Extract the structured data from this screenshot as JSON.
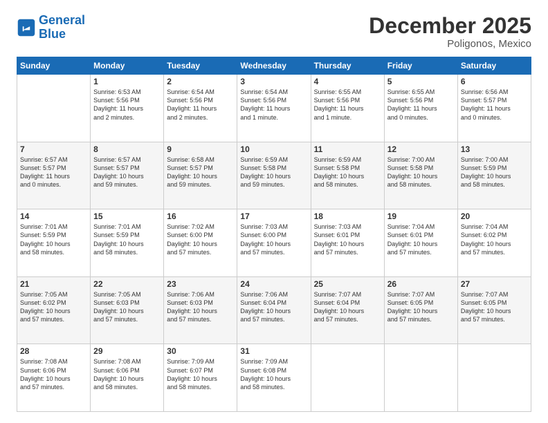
{
  "header": {
    "logo_line1": "General",
    "logo_line2": "Blue",
    "month": "December 2025",
    "location": "Poligonos, Mexico"
  },
  "days_of_week": [
    "Sunday",
    "Monday",
    "Tuesday",
    "Wednesday",
    "Thursday",
    "Friday",
    "Saturday"
  ],
  "weeks": [
    [
      {
        "day": "",
        "text": ""
      },
      {
        "day": "1",
        "text": "Sunrise: 6:53 AM\nSunset: 5:56 PM\nDaylight: 11 hours\nand 2 minutes."
      },
      {
        "day": "2",
        "text": "Sunrise: 6:54 AM\nSunset: 5:56 PM\nDaylight: 11 hours\nand 2 minutes."
      },
      {
        "day": "3",
        "text": "Sunrise: 6:54 AM\nSunset: 5:56 PM\nDaylight: 11 hours\nand 1 minute."
      },
      {
        "day": "4",
        "text": "Sunrise: 6:55 AM\nSunset: 5:56 PM\nDaylight: 11 hours\nand 1 minute."
      },
      {
        "day": "5",
        "text": "Sunrise: 6:55 AM\nSunset: 5:56 PM\nDaylight: 11 hours\nand 0 minutes."
      },
      {
        "day": "6",
        "text": "Sunrise: 6:56 AM\nSunset: 5:57 PM\nDaylight: 11 hours\nand 0 minutes."
      }
    ],
    [
      {
        "day": "7",
        "text": "Sunrise: 6:57 AM\nSunset: 5:57 PM\nDaylight: 11 hours\nand 0 minutes."
      },
      {
        "day": "8",
        "text": "Sunrise: 6:57 AM\nSunset: 5:57 PM\nDaylight: 10 hours\nand 59 minutes."
      },
      {
        "day": "9",
        "text": "Sunrise: 6:58 AM\nSunset: 5:57 PM\nDaylight: 10 hours\nand 59 minutes."
      },
      {
        "day": "10",
        "text": "Sunrise: 6:59 AM\nSunset: 5:58 PM\nDaylight: 10 hours\nand 59 minutes."
      },
      {
        "day": "11",
        "text": "Sunrise: 6:59 AM\nSunset: 5:58 PM\nDaylight: 10 hours\nand 58 minutes."
      },
      {
        "day": "12",
        "text": "Sunrise: 7:00 AM\nSunset: 5:58 PM\nDaylight: 10 hours\nand 58 minutes."
      },
      {
        "day": "13",
        "text": "Sunrise: 7:00 AM\nSunset: 5:59 PM\nDaylight: 10 hours\nand 58 minutes."
      }
    ],
    [
      {
        "day": "14",
        "text": "Sunrise: 7:01 AM\nSunset: 5:59 PM\nDaylight: 10 hours\nand 58 minutes."
      },
      {
        "day": "15",
        "text": "Sunrise: 7:01 AM\nSunset: 5:59 PM\nDaylight: 10 hours\nand 58 minutes."
      },
      {
        "day": "16",
        "text": "Sunrise: 7:02 AM\nSunset: 6:00 PM\nDaylight: 10 hours\nand 57 minutes."
      },
      {
        "day": "17",
        "text": "Sunrise: 7:03 AM\nSunset: 6:00 PM\nDaylight: 10 hours\nand 57 minutes."
      },
      {
        "day": "18",
        "text": "Sunrise: 7:03 AM\nSunset: 6:01 PM\nDaylight: 10 hours\nand 57 minutes."
      },
      {
        "day": "19",
        "text": "Sunrise: 7:04 AM\nSunset: 6:01 PM\nDaylight: 10 hours\nand 57 minutes."
      },
      {
        "day": "20",
        "text": "Sunrise: 7:04 AM\nSunset: 6:02 PM\nDaylight: 10 hours\nand 57 minutes."
      }
    ],
    [
      {
        "day": "21",
        "text": "Sunrise: 7:05 AM\nSunset: 6:02 PM\nDaylight: 10 hours\nand 57 minutes."
      },
      {
        "day": "22",
        "text": "Sunrise: 7:05 AM\nSunset: 6:03 PM\nDaylight: 10 hours\nand 57 minutes."
      },
      {
        "day": "23",
        "text": "Sunrise: 7:06 AM\nSunset: 6:03 PM\nDaylight: 10 hours\nand 57 minutes."
      },
      {
        "day": "24",
        "text": "Sunrise: 7:06 AM\nSunset: 6:04 PM\nDaylight: 10 hours\nand 57 minutes."
      },
      {
        "day": "25",
        "text": "Sunrise: 7:07 AM\nSunset: 6:04 PM\nDaylight: 10 hours\nand 57 minutes."
      },
      {
        "day": "26",
        "text": "Sunrise: 7:07 AM\nSunset: 6:05 PM\nDaylight: 10 hours\nand 57 minutes."
      },
      {
        "day": "27",
        "text": "Sunrise: 7:07 AM\nSunset: 6:05 PM\nDaylight: 10 hours\nand 57 minutes."
      }
    ],
    [
      {
        "day": "28",
        "text": "Sunrise: 7:08 AM\nSunset: 6:06 PM\nDaylight: 10 hours\nand 57 minutes."
      },
      {
        "day": "29",
        "text": "Sunrise: 7:08 AM\nSunset: 6:06 PM\nDaylight: 10 hours\nand 58 minutes."
      },
      {
        "day": "30",
        "text": "Sunrise: 7:09 AM\nSunset: 6:07 PM\nDaylight: 10 hours\nand 58 minutes."
      },
      {
        "day": "31",
        "text": "Sunrise: 7:09 AM\nSunset: 6:08 PM\nDaylight: 10 hours\nand 58 minutes."
      },
      {
        "day": "",
        "text": ""
      },
      {
        "day": "",
        "text": ""
      },
      {
        "day": "",
        "text": ""
      }
    ]
  ]
}
